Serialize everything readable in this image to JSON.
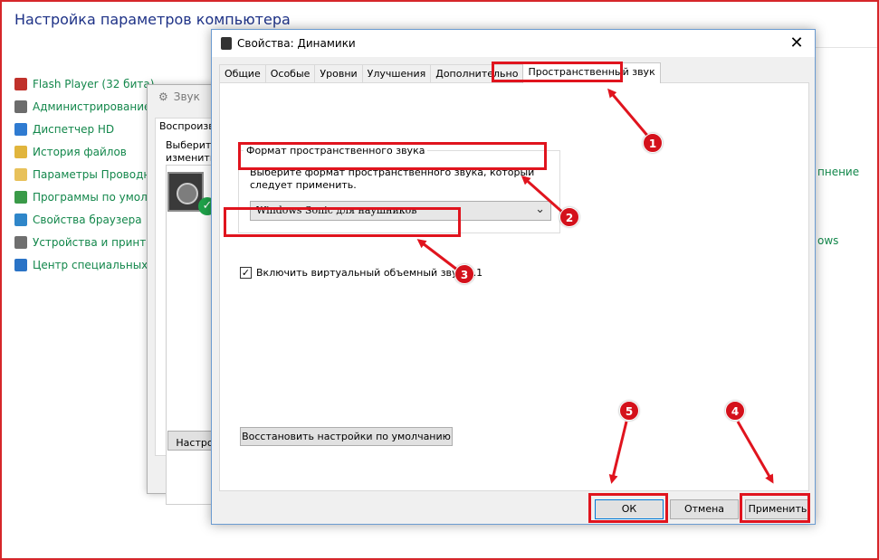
{
  "control_panel": {
    "title": "Настройка параметров компьютера",
    "items": [
      {
        "label": "Flash Player (32 бита)",
        "icon": "flash-player-icon",
        "color": "#c0312b"
      },
      {
        "label": "Администрирование",
        "icon": "admin-tools-icon",
        "color": "#6c6c6c"
      },
      {
        "label": "Диспетчер HD",
        "icon": "hd-manager-icon",
        "color": "#2f7bd1"
      },
      {
        "label": "История файлов",
        "icon": "file-history-icon",
        "color": "#e1b53d"
      },
      {
        "label": "Параметры Проводник",
        "icon": "explorer-options-icon",
        "color": "#e8c15a"
      },
      {
        "label": "Программы по умолча",
        "icon": "default-programs-icon",
        "color": "#3a9a48"
      },
      {
        "label": "Свойства браузера",
        "icon": "browser-properties-icon",
        "color": "#2f86c9"
      },
      {
        "label": "Устройства и принтеры",
        "icon": "devices-printers-icon",
        "color": "#6f6f6f"
      },
      {
        "label": "Центр специальных во",
        "icon": "ease-of-access-icon",
        "color": "#2a73c6"
      }
    ],
    "right_text_1": "пнение",
    "right_text_2": "ows"
  },
  "sound_window": {
    "title": "Звук",
    "tab": "Воспроизвед",
    "text_line1": "Выберит",
    "text_line2": "изменить",
    "button": "Настро"
  },
  "dialog": {
    "title": "Свойства: Динамики",
    "tabs": [
      "Общие",
      "Особые",
      "Уровни",
      "Улучшения",
      "Дополнительно",
      "Пространственный звук"
    ],
    "active_tab": 5,
    "group_label": "Формат пространственного звука",
    "group_desc": "Выберите формат пространственного звука, который следует применить.",
    "format_select": "Windows Sonic для наушников",
    "checkbox_label": "Включить виртуальный объемный звук 7.1",
    "checkbox_checked": true,
    "restore_button": "Восстановить настройки по умолчанию",
    "ok": "ОК",
    "cancel": "Отмена",
    "apply": "Применить"
  },
  "annotations": {
    "color": "#e0141e",
    "badges": [
      "1",
      "2",
      "3",
      "4",
      "5"
    ]
  }
}
